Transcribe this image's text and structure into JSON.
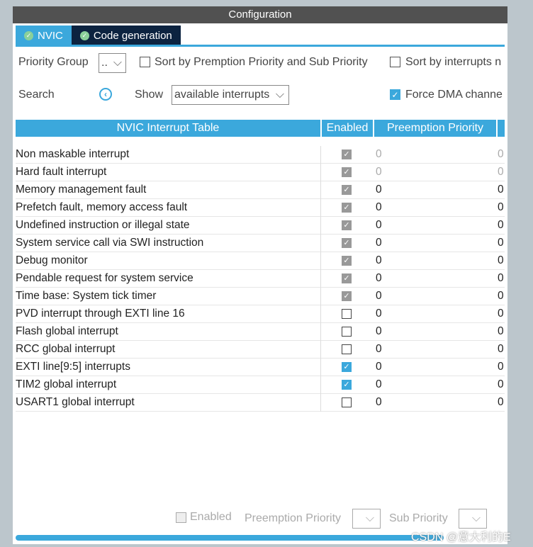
{
  "window": {
    "title": "Configuration"
  },
  "tabs": [
    {
      "label": "NVIC"
    },
    {
      "label": "Code generation"
    }
  ],
  "controls": {
    "priority_group_label": "Priority Group",
    "priority_group_value": "..",
    "sort_premption": "Sort by Premption Priority and Sub Priority",
    "sort_interrupts": "Sort by interrupts n",
    "search_label": "Search",
    "show_label": "Show",
    "show_value": "available interrupts",
    "force_dma": "Force DMA channe"
  },
  "table": {
    "headers": [
      "NVIC Interrupt Table",
      "Enabled",
      "Preemption Priority"
    ],
    "rows": [
      {
        "name": "Non maskable interrupt",
        "enabled": true,
        "locked": true,
        "preemption": "0",
        "sub": "0"
      },
      {
        "name": "Hard fault interrupt",
        "enabled": true,
        "locked": true,
        "preemption": "0",
        "sub": "0"
      },
      {
        "name": "Memory management fault",
        "enabled": true,
        "locked": true,
        "preemption": "0",
        "sub": "0"
      },
      {
        "name": "Prefetch fault, memory access fault",
        "enabled": true,
        "locked": true,
        "preemption": "0",
        "sub": "0"
      },
      {
        "name": "Undefined instruction or illegal state",
        "enabled": true,
        "locked": true,
        "preemption": "0",
        "sub": "0"
      },
      {
        "name": "System service call via SWI instruction",
        "enabled": true,
        "locked": true,
        "preemption": "0",
        "sub": "0"
      },
      {
        "name": "Debug monitor",
        "enabled": true,
        "locked": true,
        "preemption": "0",
        "sub": "0"
      },
      {
        "name": "Pendable request for system service",
        "enabled": true,
        "locked": true,
        "preemption": "0",
        "sub": "0"
      },
      {
        "name": "Time base: System tick timer",
        "enabled": true,
        "locked": true,
        "preemption": "0",
        "sub": "0"
      },
      {
        "name": "PVD interrupt through EXTI line 16",
        "enabled": false,
        "locked": false,
        "preemption": "0",
        "sub": "0"
      },
      {
        "name": "Flash global interrupt",
        "enabled": false,
        "locked": false,
        "preemption": "0",
        "sub": "0"
      },
      {
        "name": "RCC global interrupt",
        "enabled": false,
        "locked": false,
        "preemption": "0",
        "sub": "0"
      },
      {
        "name": "EXTI line[9:5] interrupts",
        "enabled": true,
        "locked": false,
        "preemption": "0",
        "sub": "0"
      },
      {
        "name": "TIM2 global interrupt",
        "enabled": true,
        "locked": false,
        "preemption": "0",
        "sub": "0"
      },
      {
        "name": "USART1 global interrupt",
        "enabled": false,
        "locked": false,
        "preemption": "0",
        "sub": "0"
      }
    ]
  },
  "footer": {
    "enabled": "Enabled",
    "preemption": "Preemption Priority",
    "sub": "Sub Priority"
  },
  "watermark": "CSDN @意大利的E"
}
